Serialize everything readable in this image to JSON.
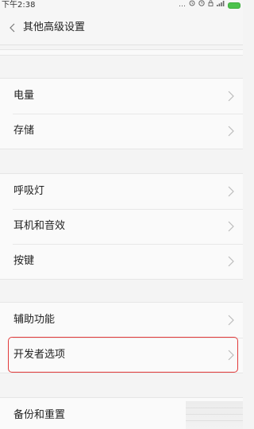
{
  "status_bar": {
    "time": "下午2:38",
    "icons": [
      "more-dots-icon",
      "alarm-icon",
      "clock-icon",
      "lock-icon",
      "signal-icon",
      "battery-icon"
    ]
  },
  "header": {
    "back_icon": "chevron-left-icon",
    "title": "其他高级设置"
  },
  "sections": [
    {
      "items": [
        {
          "label": ""
        }
      ]
    },
    {
      "items": [
        {
          "label": "电量"
        },
        {
          "label": "存储"
        }
      ]
    },
    {
      "items": [
        {
          "label": "呼吸灯"
        },
        {
          "label": "耳机和音效"
        },
        {
          "label": "按键"
        }
      ]
    },
    {
      "items": [
        {
          "label": "辅助功能"
        },
        {
          "label": "开发者选项",
          "highlighted": true
        }
      ]
    },
    {
      "items": [
        {
          "label": "备份和重置"
        }
      ]
    }
  ],
  "colors": {
    "highlight": "#e23a3a",
    "battery": "#4cc24c",
    "background": "#f4f4f4"
  }
}
